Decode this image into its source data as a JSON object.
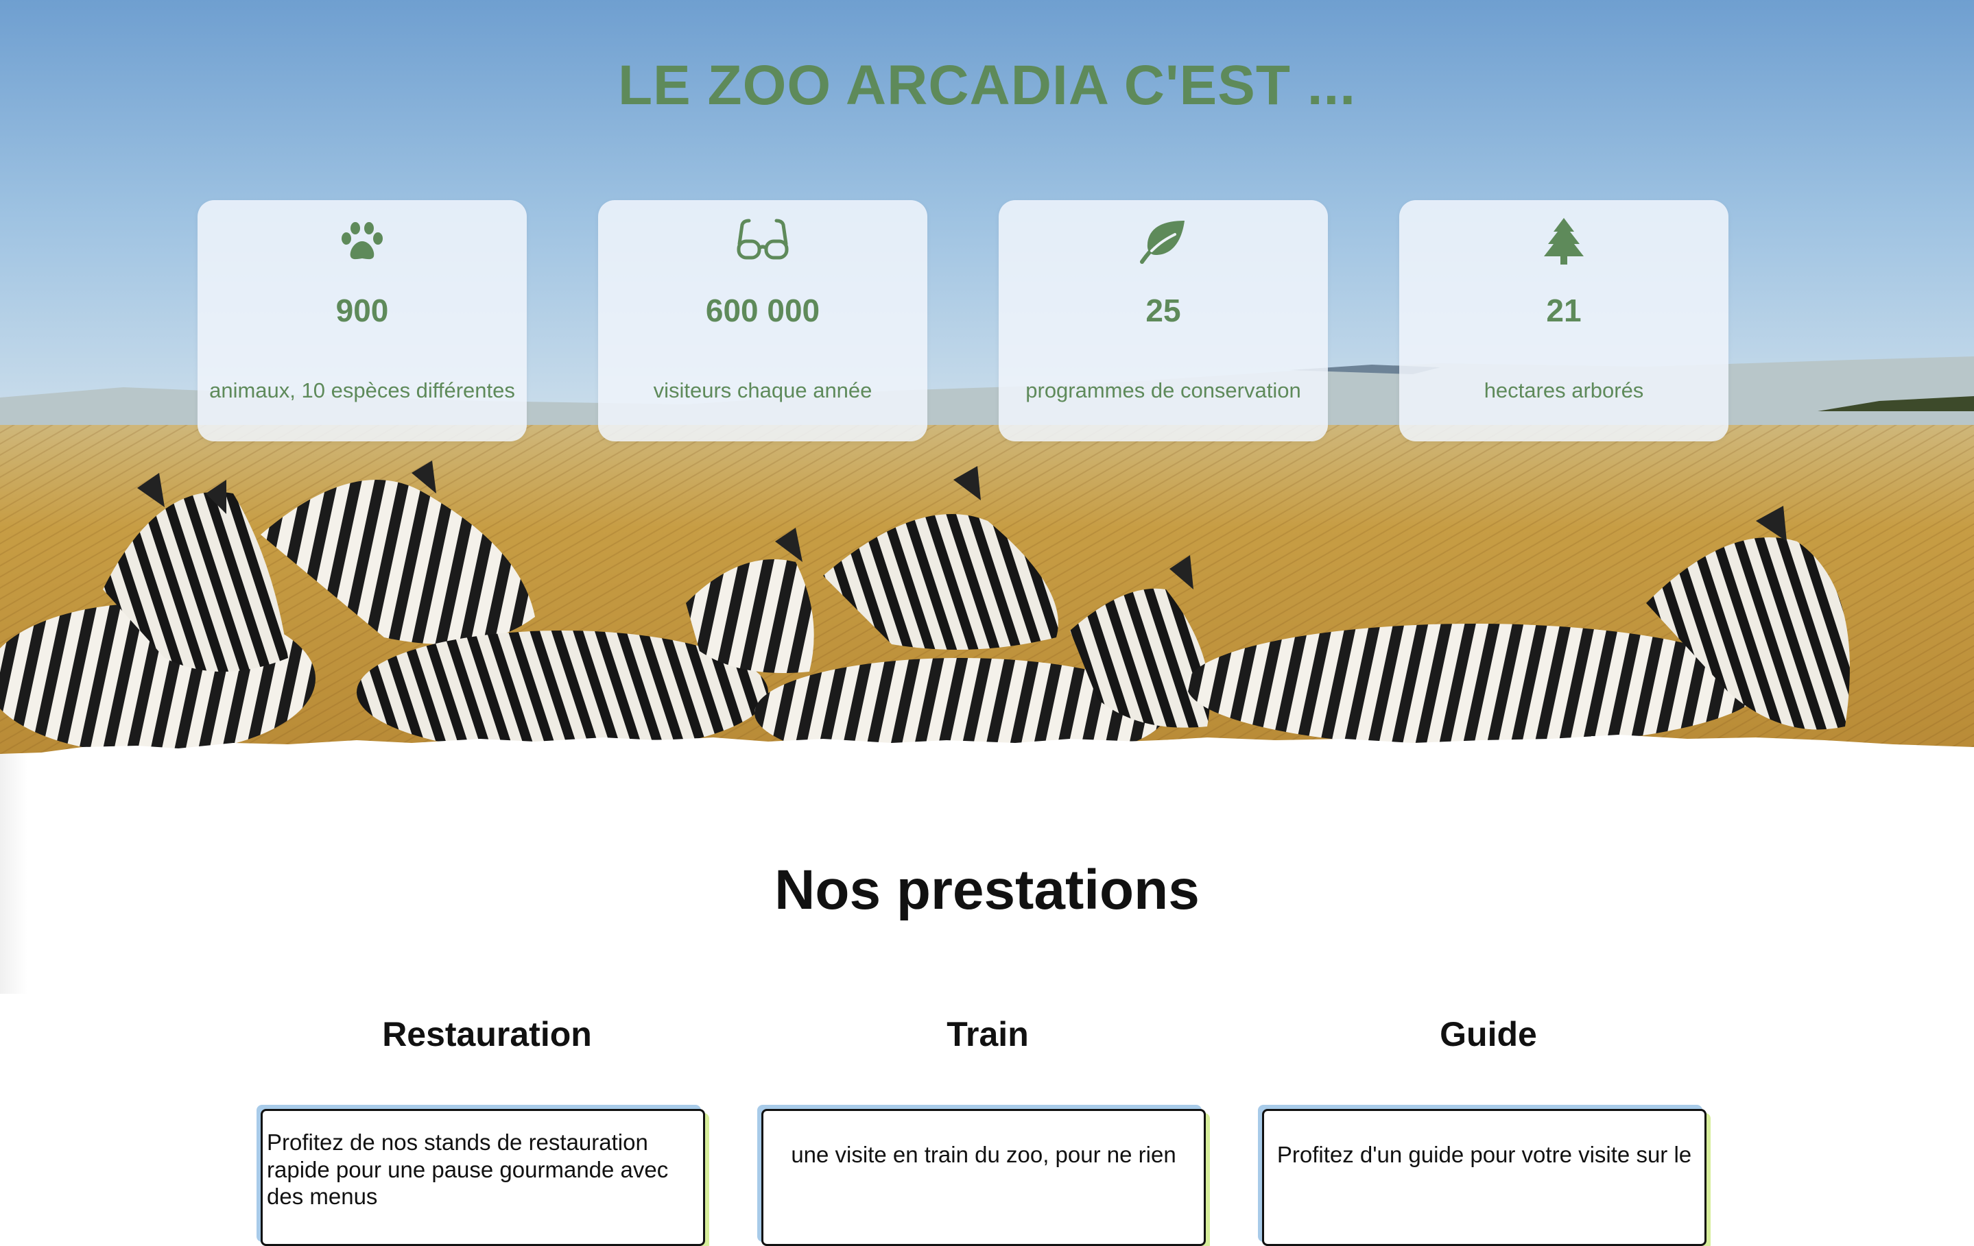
{
  "hero": {
    "title": "LE ZOO ARCADIA C'EST ...",
    "stats": [
      {
        "icon": "paw-icon",
        "value": "900",
        "label": "animaux, 10 espèces différentes"
      },
      {
        "icon": "glasses-icon",
        "value": "600 000",
        "label": "visiteurs chaque année"
      },
      {
        "icon": "leaf-icon",
        "value": "25",
        "label": "programmes de conservation"
      },
      {
        "icon": "tree-icon",
        "value": "21",
        "label": "hectares arborés"
      }
    ]
  },
  "services": {
    "title": "Nos prestations",
    "items": [
      {
        "name": "Restauration",
        "description": "Profitez de nos stands de restauration rapide pour une pause gourmande avec des menus"
      },
      {
        "name": "Train",
        "description": "une visite en train du zoo, pour ne rien"
      },
      {
        "name": "Guide",
        "description": "Profitez d'un guide pour votre visite sur le"
      }
    ]
  },
  "colors": {
    "accent_green": "#5e8a5a",
    "card_shadow_blue": "#a8cbe9",
    "card_shadow_lime": "#d7ee9b"
  }
}
